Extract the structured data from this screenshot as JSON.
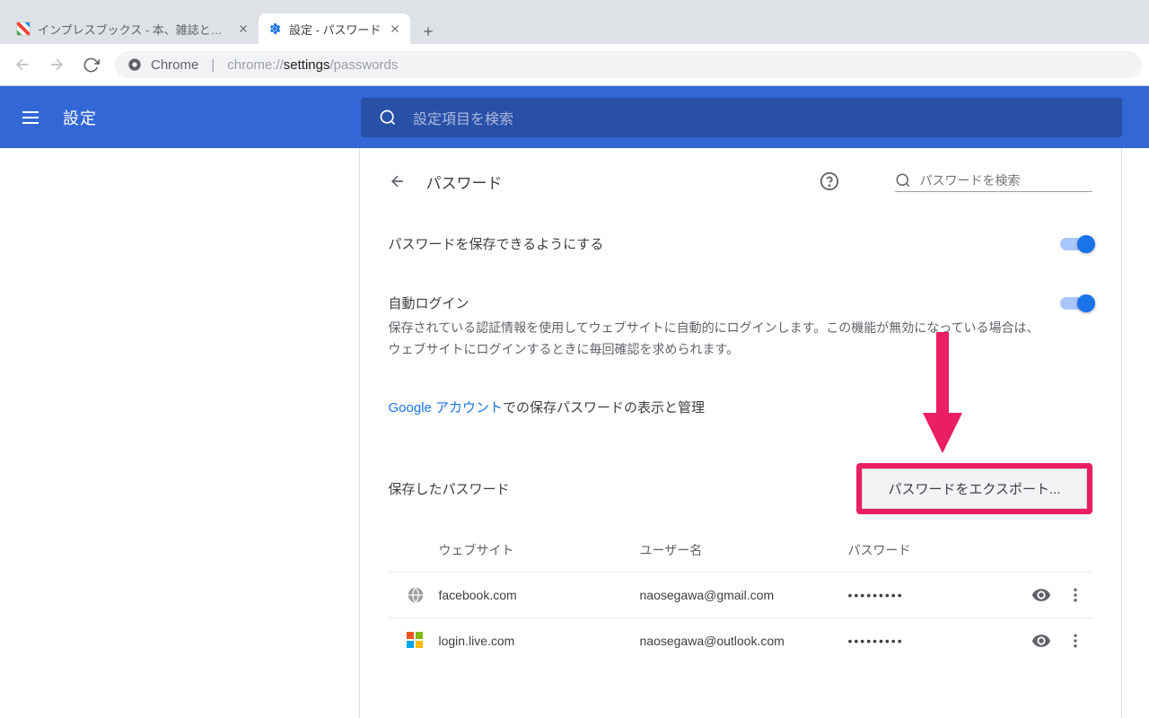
{
  "browser": {
    "tabs": [
      {
        "title": "インプレスブックス - 本、雑誌と関連W",
        "active": false
      },
      {
        "title": "設定 - パスワード",
        "active": true
      }
    ],
    "omnibox": {
      "branding": "Chrome",
      "url_left": "chrome://",
      "url_mid": "settings",
      "url_right": "/passwords"
    }
  },
  "header": {
    "title": "設定",
    "search_placeholder": "設定項目を検索"
  },
  "page": {
    "back_title": "パスワード",
    "inner_search_placeholder": "パスワードを検索",
    "offer_save": {
      "label": "パスワードを保存できるようにする",
      "on": true
    },
    "autosignin": {
      "label": "自動ログイン",
      "desc": "保存されている認証情報を使用してウェブサイトに自動的にログインします。この機能が無効になっている場合は、ウェブサイトにログインするときに毎回確認を求められます。",
      "on": true
    },
    "google_link": {
      "link": "Google アカウント",
      "rest": "での保存パスワードの表示と管理"
    },
    "saved_section": "保存したパスワード",
    "export_button": "パスワードをエクスポート...",
    "columns": {
      "site": "ウェブサイト",
      "user": "ユーザー名",
      "pass": "パスワード"
    },
    "rows": [
      {
        "icon": "globe",
        "site": "facebook.com",
        "user": "naosegawa@gmail.com",
        "pass": "•••••••••"
      },
      {
        "icon": "microsoft",
        "site": "login.live.com",
        "user": "naosegawa@outlook.com",
        "pass": "•••••••••"
      }
    ]
  }
}
